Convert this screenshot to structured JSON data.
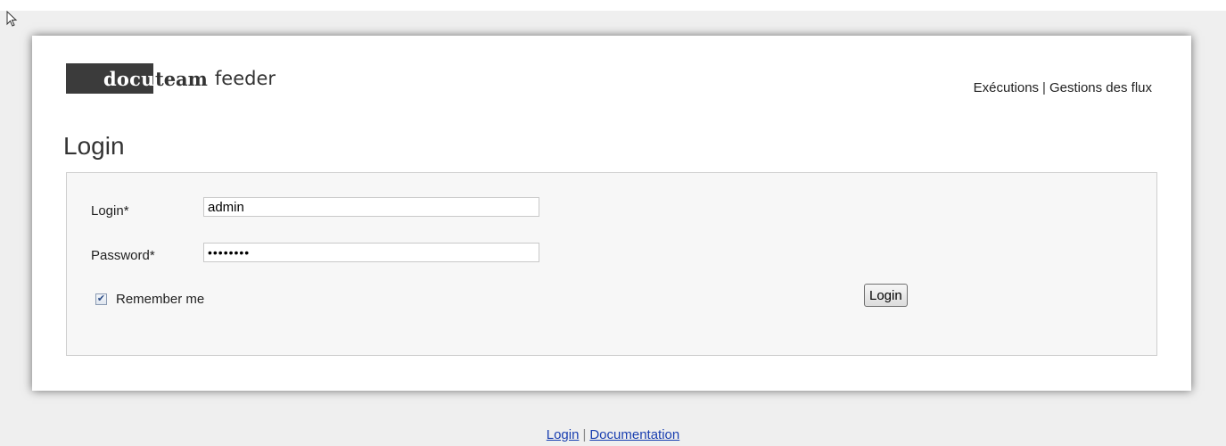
{
  "header": {
    "logo": {
      "docu": "docu",
      "team": "team",
      "feeder": "feeder"
    },
    "nav": {
      "executions": "Exécutions",
      "separator": "|",
      "flows": "Gestions des flux"
    }
  },
  "page": {
    "title": "Login"
  },
  "form": {
    "login_label": "Login*",
    "login_value": "admin",
    "password_label": "Password*",
    "password_value": "••••••••",
    "remember_checked": true,
    "remember_label": "Remember me",
    "submit_label": "Login"
  },
  "footer": {
    "login_link": "Login",
    "separator": "|",
    "documentation_link": "Documentation"
  },
  "colors": {
    "page_background": "#efefef",
    "logo_dark": "#3b3b3b",
    "link": "#1a3fb0"
  },
  "icons": {
    "cursor": "pointer-cursor-icon",
    "checkbox": "checkmark-icon"
  }
}
